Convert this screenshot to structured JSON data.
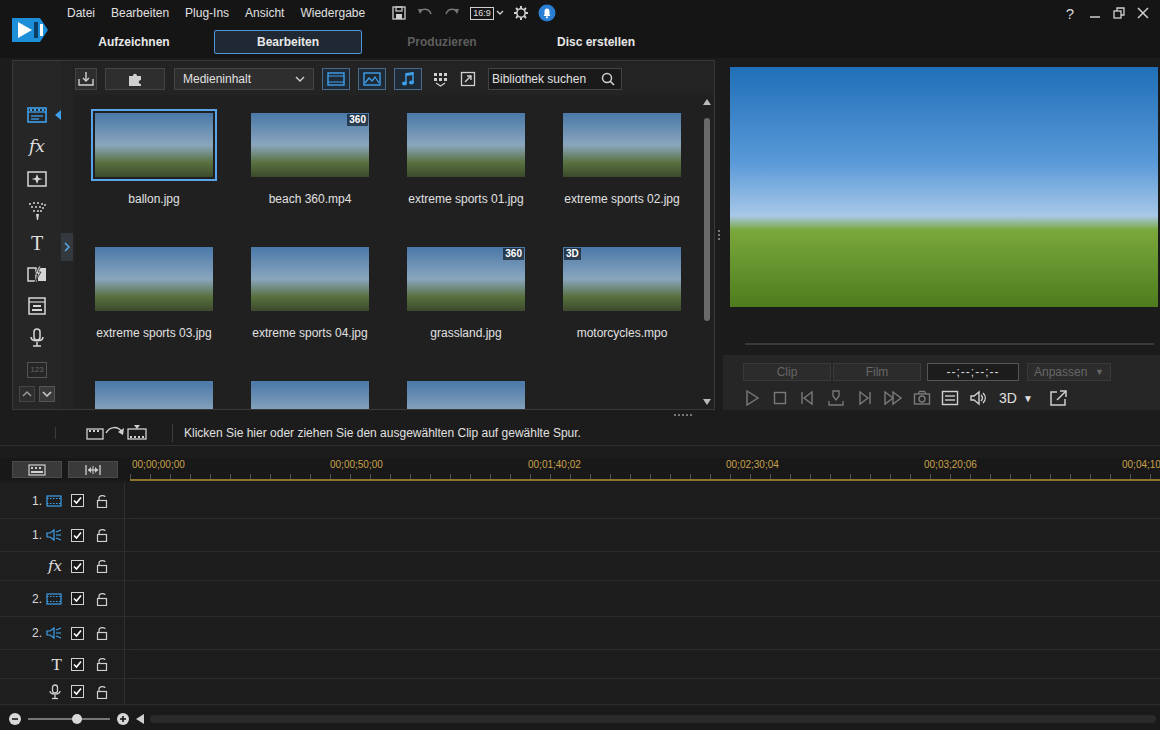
{
  "app": {
    "menu": [
      "Datei",
      "Bearbeiten",
      "Plug-Ins",
      "Ansicht",
      "Wiedergabe"
    ],
    "aspect": "16:9",
    "help": "?"
  },
  "modes": [
    {
      "label": "Aufzeichnen",
      "selected": false,
      "disabled": false
    },
    {
      "label": "Bearbeiten",
      "selected": true,
      "disabled": false
    },
    {
      "label": "Produzieren",
      "selected": false,
      "disabled": true
    },
    {
      "label": "Disc erstellen",
      "selected": false,
      "disabled": false
    }
  ],
  "sidebar": {
    "items": [
      {
        "kind": "media",
        "label": "",
        "selected": true,
        "disabled": false
      },
      {
        "kind": "effects",
        "label": "fx",
        "selected": false,
        "disabled": false
      },
      {
        "kind": "pip",
        "label": "",
        "selected": false,
        "disabled": false
      },
      {
        "kind": "particle",
        "label": "",
        "selected": false,
        "disabled": false
      },
      {
        "kind": "title",
        "label": "T",
        "selected": false,
        "disabled": false
      },
      {
        "kind": "transition",
        "label": "",
        "selected": false,
        "disabled": false
      },
      {
        "kind": "subtitle",
        "label": "",
        "selected": false,
        "disabled": false
      },
      {
        "kind": "voice",
        "label": "",
        "selected": false,
        "disabled": false
      },
      {
        "kind": "chapter",
        "label": "123",
        "selected": false,
        "disabled": true
      }
    ]
  },
  "library": {
    "filter": "Medieninhalt",
    "views": [
      {
        "kind": "video",
        "on": true
      },
      {
        "kind": "image",
        "on": true
      },
      {
        "kind": "audio",
        "on": true
      }
    ],
    "search_placeholder": "Bibliothek suchen",
    "scroll": {
      "level": 0.73
    },
    "items": [
      {
        "name": "ballon.jpg",
        "kind": "photo",
        "badge": "",
        "selected": true
      },
      {
        "name": "beach 360.mp4",
        "kind": "video-360",
        "badge": "360",
        "selected": false
      },
      {
        "name": "extreme sports 01.jpg",
        "kind": "photo",
        "badge": "",
        "selected": false
      },
      {
        "name": "extreme sports 02.jpg",
        "kind": "photo",
        "badge": "",
        "selected": false
      },
      {
        "name": "extreme sports 03.jpg",
        "kind": "photo",
        "badge": "",
        "selected": false
      },
      {
        "name": "extreme sports 04.jpg",
        "kind": "photo",
        "badge": "",
        "selected": false
      },
      {
        "name": "grassland.jpg",
        "kind": "photo-360",
        "badge": "360",
        "selected": false
      },
      {
        "name": "motorcycles.mpo",
        "kind": "photo-3d",
        "badge": "3D",
        "selected": false
      },
      {
        "name": "",
        "kind": "photo",
        "badge": "",
        "selected": false
      },
      {
        "name": "",
        "kind": "photo",
        "badge": "",
        "selected": false
      },
      {
        "name": "",
        "kind": "photo",
        "badge": "",
        "selected": false
      }
    ]
  },
  "preview": {
    "segments": [
      {
        "label": "Clip",
        "selected": false,
        "disabled": true
      },
      {
        "label": "Film",
        "selected": false,
        "disabled": true
      }
    ],
    "timecode": "--;--;--;--",
    "fit": {
      "label": "Anpassen",
      "arrow": "▼",
      "disabled": true
    },
    "position": {
      "level": 0
    },
    "transport": [
      {
        "kind": "play",
        "disabled": true
      },
      {
        "kind": "stop",
        "disabled": true
      },
      {
        "kind": "prev",
        "disabled": true
      },
      {
        "kind": "step",
        "disabled": true
      },
      {
        "kind": "next",
        "disabled": true
      },
      {
        "kind": "fast",
        "disabled": true
      },
      {
        "kind": "snapshot",
        "disabled": true
      },
      {
        "kind": "subtitles",
        "disabled": false
      },
      {
        "kind": "volume",
        "disabled": false
      }
    ],
    "stereo": {
      "label": "3D",
      "arrow": "▼"
    }
  },
  "hint": "Klicken Sie hier oder ziehen Sie den ausgewählten Clip auf gewählte Spur.",
  "timeline": {
    "ruler": [
      "00;00;00;00",
      "00;00;50;00",
      "00;01;40;02",
      "00;02;30;04",
      "00;03;20;06",
      "00;04;10"
    ],
    "tracks": [
      {
        "number": "1.",
        "kind": "video",
        "label": "",
        "enabled": true,
        "locked": false
      },
      {
        "number": "1.",
        "kind": "audio",
        "label": "",
        "enabled": true,
        "locked": false
      },
      {
        "number": "",
        "kind": "effects",
        "label": "fx",
        "enabled": true,
        "locked": false
      },
      {
        "number": "2.",
        "kind": "video",
        "label": "",
        "enabled": true,
        "locked": false
      },
      {
        "number": "2.",
        "kind": "audio",
        "label": "",
        "enabled": true,
        "locked": false
      },
      {
        "number": "",
        "kind": "title",
        "label": "T",
        "enabled": true,
        "locked": false
      },
      {
        "number": "",
        "kind": "voice",
        "label": "",
        "enabled": true,
        "locked": false
      }
    ],
    "zoom": {
      "level": 0.6
    }
  }
}
